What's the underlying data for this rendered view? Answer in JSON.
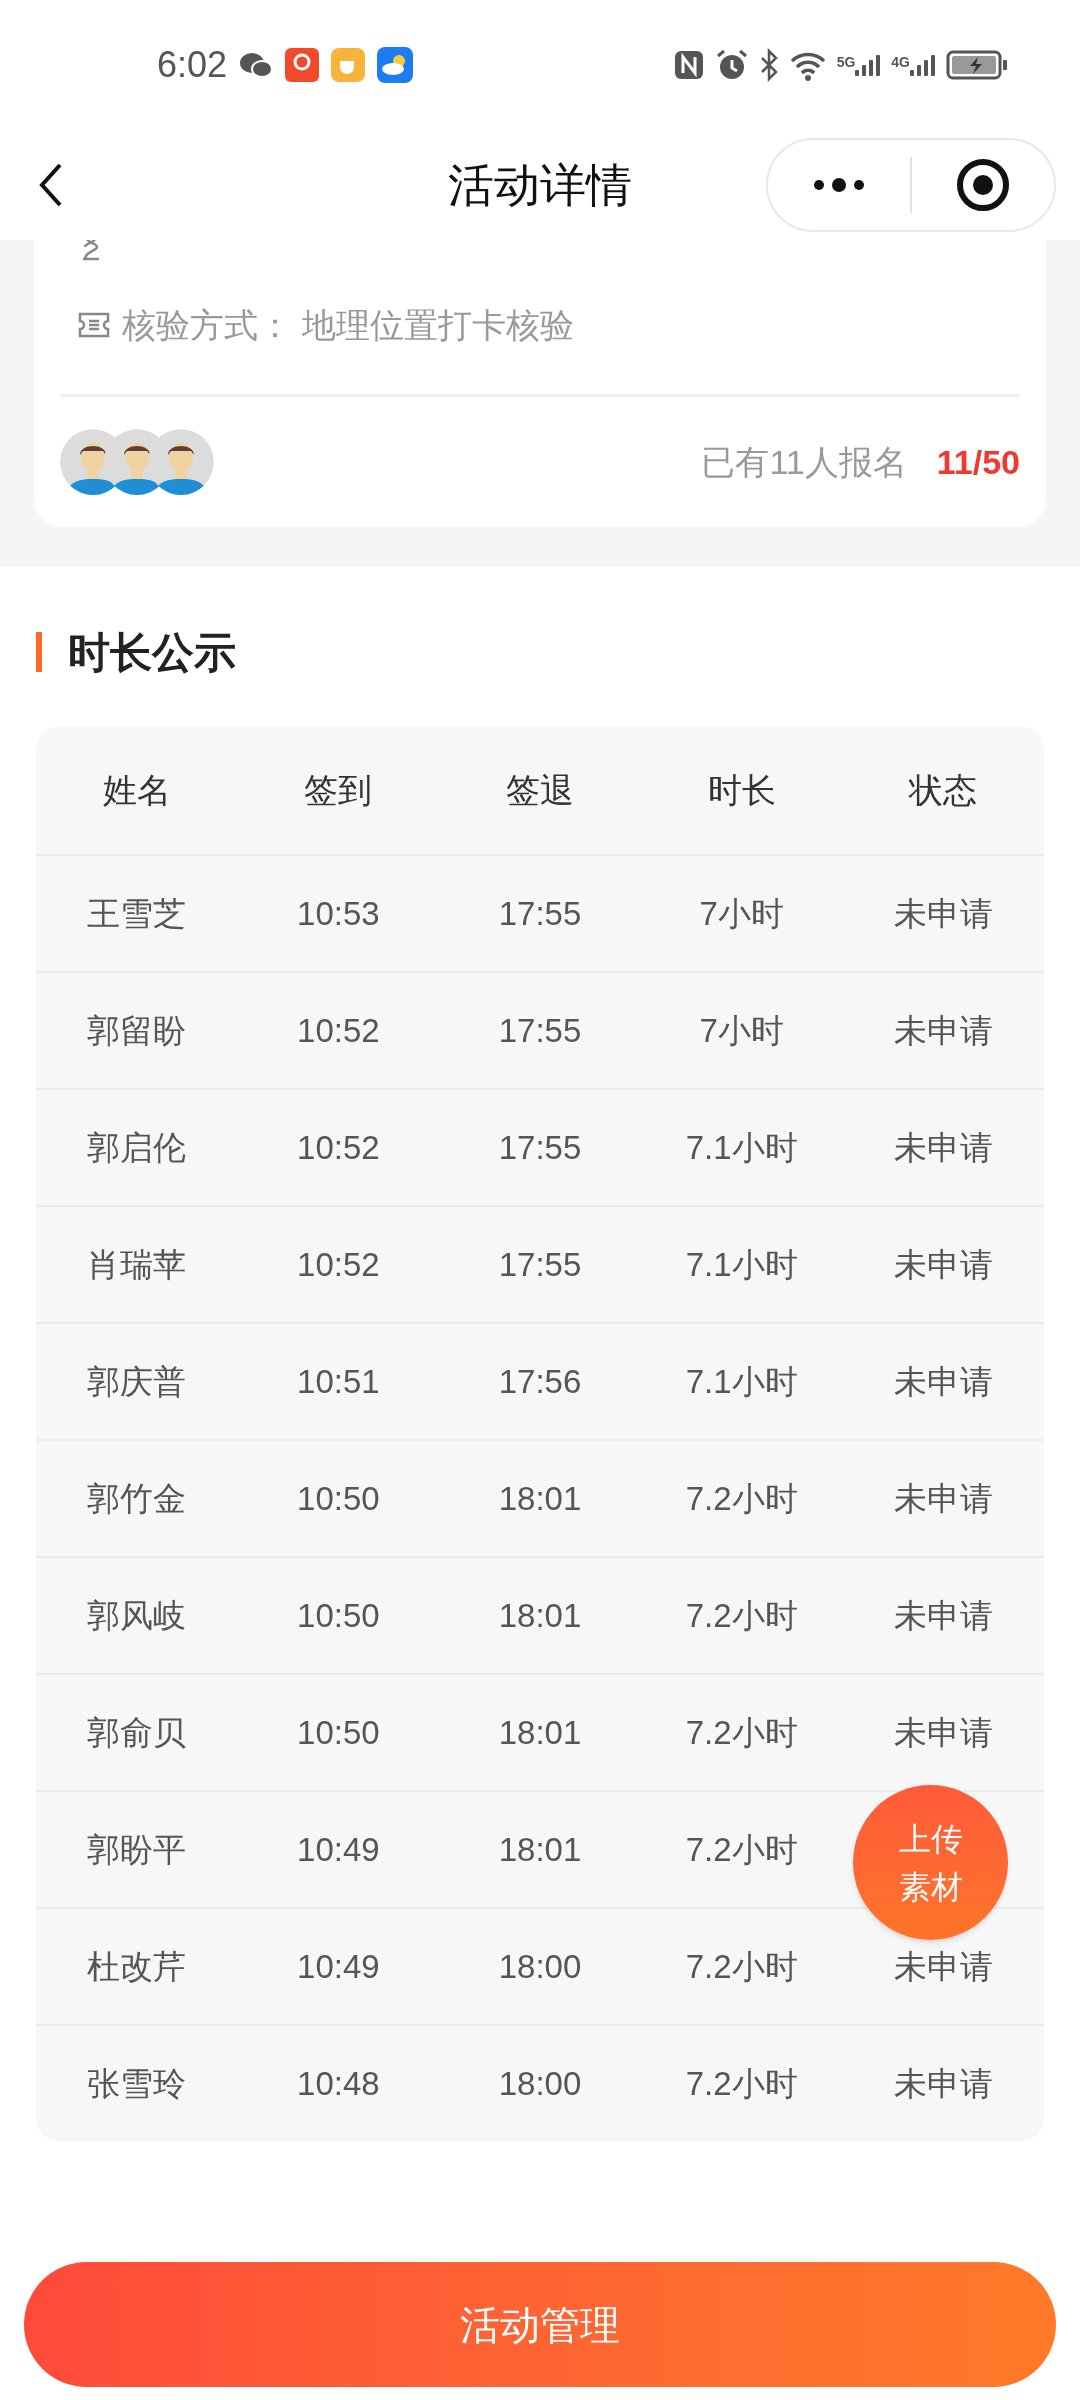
{
  "status_bar": {
    "time": "6:02",
    "net_5g": "5G",
    "net_4g": "4G"
  },
  "nav": {
    "title": "活动详情"
  },
  "info": [
    {
      "kind": "time"
    },
    {
      "kind": "verify",
      "label": "核验方式：",
      "value": "地理位置打卡核验"
    }
  ],
  "signup": {
    "text": "已有11人报名",
    "count": "11/50"
  },
  "section_title": "时长公示",
  "table": {
    "columns": [
      "姓名",
      "签到",
      "签退",
      "时长",
      "状态"
    ],
    "rows": [
      [
        "王雪芝",
        "10:53",
        "17:55",
        "7小时",
        "未申请"
      ],
      [
        "郭留盼",
        "10:52",
        "17:55",
        "7小时",
        "未申请"
      ],
      [
        "郭启伦",
        "10:52",
        "17:55",
        "7.1小时",
        "未申请"
      ],
      [
        "肖瑞苹",
        "10:52",
        "17:55",
        "7.1小时",
        "未申请"
      ],
      [
        "郭庆普",
        "10:51",
        "17:56",
        "7.1小时",
        "未申请"
      ],
      [
        "郭竹金",
        "10:50",
        "18:01",
        "7.2小时",
        "未申请"
      ],
      [
        "郭风岐",
        "10:50",
        "18:01",
        "7.2小时",
        "未申请"
      ],
      [
        "郭俞贝",
        "10:50",
        "18:01",
        "7.2小时",
        "未申请"
      ],
      [
        "郭盼平",
        "10:49",
        "18:01",
        "7.2小时"
      ],
      [
        "杜改芹",
        "10:49",
        "18:00",
        "7.2小时",
        "未申请"
      ],
      [
        "张雪玲",
        "10:48",
        "18:00",
        "7.2小时",
        "未申请"
      ]
    ]
  },
  "float_button": {
    "line1": "上传",
    "line2": "素材"
  },
  "bottom_button": "活动管理"
}
